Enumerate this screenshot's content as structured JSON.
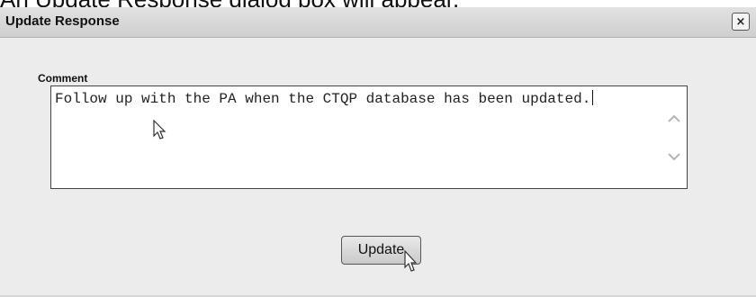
{
  "caption": {
    "text": "An Update Response dialog box will appear."
  },
  "dialog": {
    "title": "Update Response",
    "close_label": "×"
  },
  "form": {
    "comment_label": "Comment",
    "comment_value": "Follow up with the PA when the CTQP database has been updated."
  },
  "actions": {
    "update_label": "Update"
  },
  "icons": {
    "close": "close-icon",
    "scroll_up": "chevron-up-icon",
    "scroll_down": "chevron-down-icon",
    "mouse_cursor": "arrow-cursor-icon"
  },
  "colors": {
    "title_bar": "#d6d6d6",
    "dialog_background": "#ececec",
    "button_face": "#d9d9d9",
    "border": "#444444"
  }
}
